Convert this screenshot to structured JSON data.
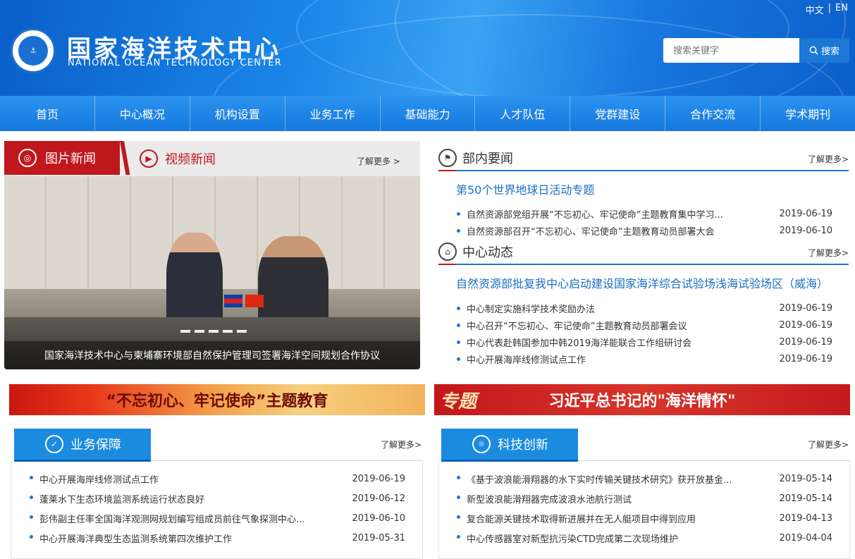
{
  "header": {
    "lang_cn": "中文",
    "lang_sep": "|",
    "lang_en": "EN",
    "site_name_cn": "国家海洋技术中心",
    "site_name_en": "NATIONAL OCEAN TECHNOLOGY CENTER",
    "search_placeholder": "搜索关键字",
    "search_button": "搜索"
  },
  "nav": [
    "首页",
    "中心概况",
    "机构设置",
    "业务工作",
    "基础能力",
    "人才队伍",
    "党群建设",
    "合作交流",
    "学术期刊"
  ],
  "photo_news": {
    "tab_active": "图片新闻",
    "tab_inactive": "视频新闻",
    "more": "了解更多 >",
    "caption": "国家海洋技术中心与柬埔寨环境部自然保护管理司签署海洋空间规划合作协议"
  },
  "ministry_news": {
    "title": "部内要闻",
    "more": "了解更多>",
    "featured": "第50个世界地球日活动专题",
    "items": [
      {
        "title": "自然资源部党组开展“不忘初心、牢记使命”主题教育集中学习...",
        "date": "2019-06-19"
      },
      {
        "title": "自然资源部召开“不忘初心、牢记使命”主题教育动员部署大会",
        "date": "2019-06-10"
      }
    ]
  },
  "center_news": {
    "title": "中心动态",
    "more": "了解更多>",
    "featured": "自然资源部批复我中心启动建设国家海洋综合试验场浅海试验场区（威海）",
    "items": [
      {
        "title": "中心制定实施科学技术奖励办法",
        "date": "2019-06-19"
      },
      {
        "title": "中心召开“不忘初心、牢记使命”主题教育动员部署会议",
        "date": "2019-06-19"
      },
      {
        "title": "中心代表赴韩国参加中韩2019海洋能联合工作组研讨会",
        "date": "2019-06-19"
      },
      {
        "title": "中心开展海岸线修测试点工作",
        "date": "2019-06-19"
      }
    ]
  },
  "banners": {
    "left": "“不忘初心、牢记使命”主题教育",
    "right_tag": "专题",
    "right": "习近平总书记的\"海洋情怀\""
  },
  "business": {
    "title": "业务保障",
    "more": "了解更多>",
    "items": [
      {
        "title": "中心开展海岸线修测试点工作",
        "date": "2019-06-19"
      },
      {
        "title": "蓬莱水下生态环境监测系统运行状态良好",
        "date": "2019-06-12"
      },
      {
        "title": "彭伟副主任率全国海洋观测网规划编写组成员前往气象探测中心...",
        "date": "2019-06-10"
      },
      {
        "title": "中心开展海洋典型生态监测系统第四次维护工作",
        "date": "2019-05-31"
      }
    ]
  },
  "innovation": {
    "title": "科技创新",
    "more": "了解更多>",
    "items": [
      {
        "title": "《基于波浪能滑翔器的水下实时传输关键技术研究》获开放基金...",
        "date": "2019-05-14"
      },
      {
        "title": "新型波浪能滑翔器完成波浪水池航行测试",
        "date": "2019-05-14"
      },
      {
        "title": "复合能源关键技术取得新进展并在无人艇项目中得到应用",
        "date": "2019-04-13"
      },
      {
        "title": "中心传感器室对新型抗污染CTD完成第二次现场维护",
        "date": "2019-04-04"
      }
    ]
  }
}
